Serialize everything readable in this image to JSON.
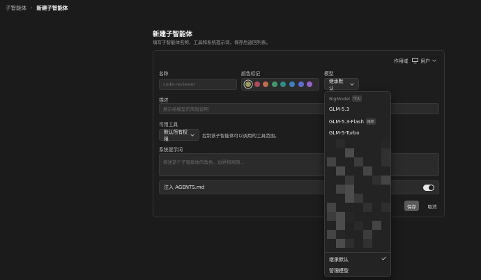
{
  "breadcrumb": {
    "parent": "子智能体",
    "current": "新建子智能体"
  },
  "page": {
    "title": "新建子智能体",
    "subtitle": "填写子智能体名称、工具和系统提示词，保存后返回列表。"
  },
  "scope": {
    "label": "作用域",
    "value": "用户"
  },
  "form": {
    "name_label": "名称",
    "name_placeholder": "code-reviewer",
    "color_label": "颜色标记",
    "colors": [
      "#9a9a5a",
      "#b5485a",
      "#c26a4a",
      "#3f9a6a",
      "#2e8b8b",
      "#3f7fc2",
      "#5a6fd0",
      "#9a5fcf"
    ],
    "selected_color": "#9a9a5a",
    "model_label": "模型",
    "model_value": "继承默认",
    "desc_label": "描述",
    "desc_placeholder": "展示给模型的简短说明",
    "tools_label": "可用工具",
    "tools_value": "默认所有权限",
    "tools_hint": "控制该子智能体可以调用的工具范围。",
    "prompt_label": "系统提示词",
    "prompt_placeholder": "描述这个子智能体的角色、边界和规则...",
    "agents_label": "注入 AGENTS.md",
    "agents_enabled": true,
    "save_label": "保存",
    "cancel_label": "取消"
  },
  "model_menu": {
    "group_name": "BigModel",
    "group_badge": "个人",
    "items": [
      {
        "label": "GLM-5.3",
        "badge": ""
      },
      {
        "label": "GLM-5.3-Flash",
        "badge": "推荐"
      },
      {
        "label": "GLM-5-Turbo",
        "badge": ""
      }
    ],
    "footer_items": [
      "继承默认",
      "管理模型"
    ],
    "checked_item": "继承默认"
  }
}
